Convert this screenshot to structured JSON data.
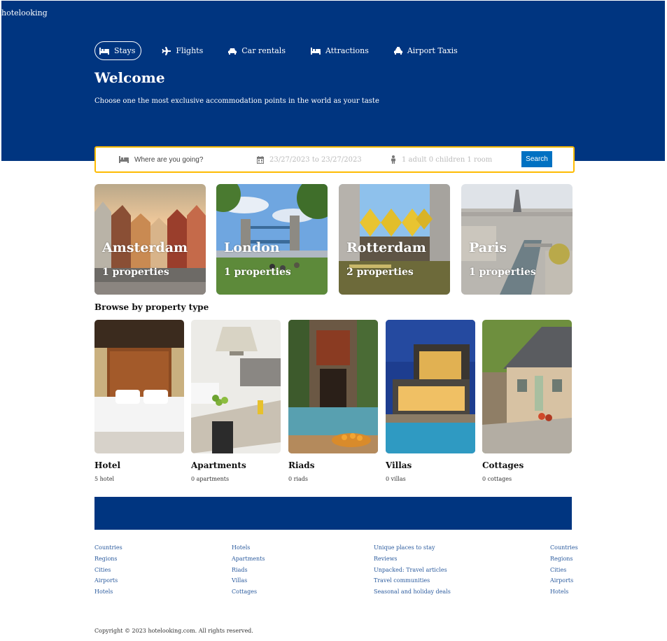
{
  "app": {
    "logo": "hotelooking"
  },
  "nav": {
    "items": [
      {
        "label": "Stays",
        "icon": "bed-icon",
        "active": true
      },
      {
        "label": "Flights",
        "icon": "plane-icon",
        "active": false
      },
      {
        "label": "Car rentals",
        "icon": "car-icon",
        "active": false
      },
      {
        "label": "Attractions",
        "icon": "bed-icon",
        "active": false
      },
      {
        "label": "Airport Taxis",
        "icon": "taxi-icon",
        "active": false
      }
    ]
  },
  "hero": {
    "title": "Welcome",
    "subtitle": "Choose one the most exclusive accommodation points in the world as your taste"
  },
  "search": {
    "destination_placeholder": "Where are you going?",
    "dates": "23/27/2023 to 23/27/2023",
    "guests": "1 adult 0 children 1 room",
    "button_label": "Search"
  },
  "cities": [
    {
      "name": "Amsterdam",
      "properties": "1 properties"
    },
    {
      "name": "London",
      "properties": "1 properties"
    },
    {
      "name": "Rotterdam",
      "properties": "2 properties"
    },
    {
      "name": "Paris",
      "properties": "1 properties"
    }
  ],
  "property_types": {
    "title": "Browse by property type",
    "items": [
      {
        "name": "Hotel",
        "count": "5 hotel"
      },
      {
        "name": "Apartments",
        "count": "0 apartments"
      },
      {
        "name": "Riads",
        "count": "0 riads"
      },
      {
        "name": "Villas",
        "count": "0 villas"
      },
      {
        "name": "Cottages",
        "count": "0 cottages"
      }
    ]
  },
  "footer": {
    "columns": [
      [
        "Countries",
        "Regions",
        "Cities",
        "Airports",
        "Hotels"
      ],
      [
        "Hotels",
        "Apartments",
        "Riads",
        "Villas",
        "Cottages"
      ],
      [
        "Unique places to stay",
        "Reviews",
        "Unpacked: Travel articles",
        "Travel communities",
        "Seasonal and holiday deals"
      ],
      [
        "Countries",
        "Regions",
        "Cities",
        "Airports",
        "Hotels"
      ]
    ],
    "copyright": "Copyright © 2023 hotelooking.com. All rights reserved."
  },
  "colors": {
    "brand": "#003580",
    "accent": "#febb02",
    "button": "#0071c2"
  }
}
